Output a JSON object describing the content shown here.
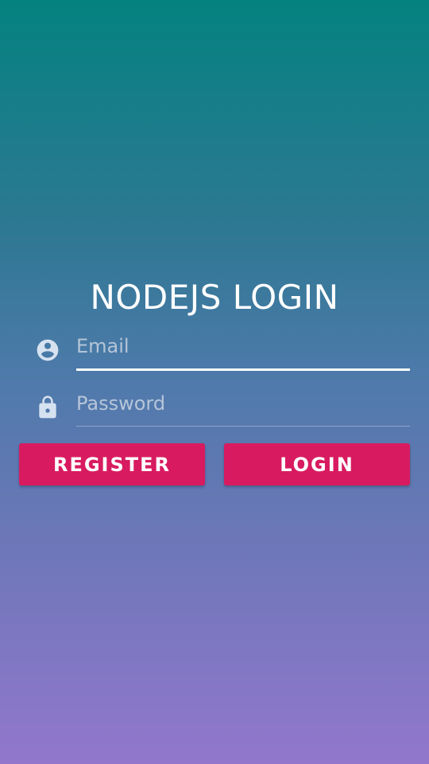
{
  "title": "NODEJS LOGIN",
  "email_field": {
    "placeholder": "Email",
    "value": "",
    "icon": "account-circle-icon"
  },
  "password_field": {
    "placeholder": "Password",
    "value": "",
    "icon": "lock-icon"
  },
  "buttons": {
    "register_label": "REGISTER",
    "login_label": "LOGIN"
  },
  "colors": {
    "gradient_top": "#048280",
    "gradient_bottom": "#9277cc",
    "button_bg": "#d81b60",
    "icon_color": "#d6e2f0",
    "text": "#ffffff"
  }
}
